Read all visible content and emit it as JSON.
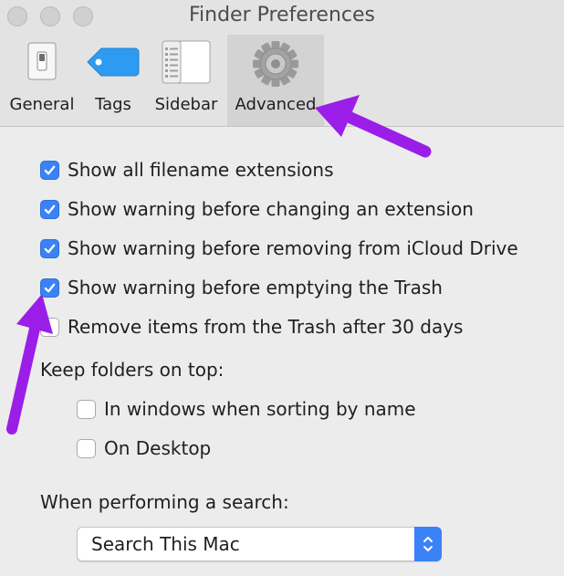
{
  "window": {
    "title": "Finder Preferences"
  },
  "traffic_lights": [
    "close",
    "minimize",
    "zoom"
  ],
  "tabs": [
    {
      "label": "General",
      "icon": "general-switch-icon",
      "selected": false
    },
    {
      "label": "Tags",
      "icon": "tag-icon",
      "selected": false
    },
    {
      "label": "Sidebar",
      "icon": "sidebar-window-icon",
      "selected": false
    },
    {
      "label": "Advanced",
      "icon": "gear-icon",
      "selected": true
    }
  ],
  "options": [
    {
      "label": "Show all filename extensions",
      "checked": true
    },
    {
      "label": "Show warning before changing an extension",
      "checked": true
    },
    {
      "label": "Show warning before removing from iCloud Drive",
      "checked": true
    },
    {
      "label": "Show warning before emptying the Trash",
      "checked": true
    },
    {
      "label": "Remove items from the Trash after 30 days",
      "checked": false
    }
  ],
  "folders_on_top": {
    "heading": "Keep folders on top:",
    "options": [
      {
        "label": "In windows when sorting by name",
        "checked": false
      },
      {
        "label": "On Desktop",
        "checked": false
      }
    ]
  },
  "search": {
    "heading": "When performing a search:",
    "selected": "Search This Mac"
  },
  "colors": {
    "accent": "#3b82f6",
    "annotation_arrow": "#9b1ee8",
    "tab_selected_bg": "#d3d3d3"
  }
}
